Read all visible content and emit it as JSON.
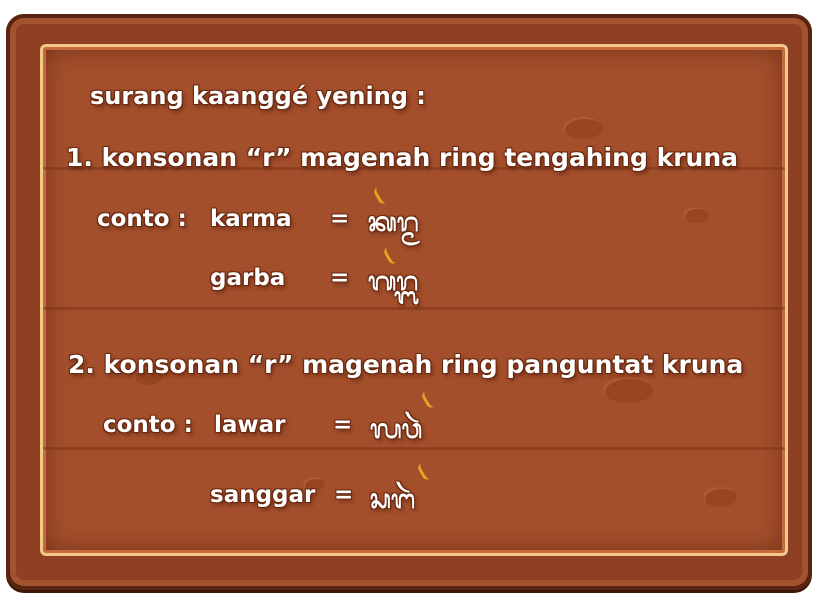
{
  "intro": "surang kaanggé yening :",
  "rules": [
    {
      "heading": "1. konsonan “r” magenah ring tengahing kruna",
      "conto_label": "conto :",
      "examples": [
        {
          "word": "karma",
          "equals": "=",
          "aksara": "ᬓᬭ᭄ᬫ"
        },
        {
          "word": "garba",
          "equals": "=",
          "aksara": "ᬕᬭ᭄ᬩ"
        }
      ]
    },
    {
      "heading": "2. konsonan “r” magenah ring panguntat kruna",
      "conto_label": "conto :",
      "examples": [
        {
          "word": "lawar",
          "equals": "=",
          "aksara": "ᬮᬯᬃ"
        },
        {
          "word": "sanggar",
          "equals": "=",
          "aksara": "ᬲᬗᬃ"
        }
      ]
    }
  ],
  "colors": {
    "board": "#8e3f24",
    "panel": "#a44f2c",
    "frame": "#f3c98a",
    "text": "#ffffff",
    "accent": "#f0a020"
  }
}
